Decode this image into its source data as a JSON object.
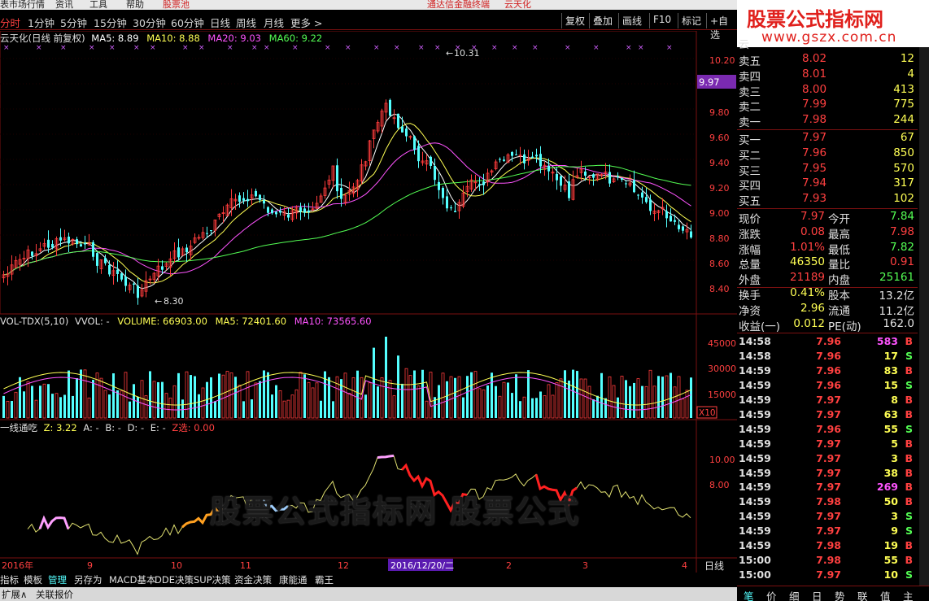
{
  "top_menu": [
    "表市场行情",
    "资讯",
    "工具",
    "帮助",
    "股票池",
    "通达信金融终端",
    "云天化"
  ],
  "period_tabs": [
    "分时",
    "1分钟",
    "5分钟",
    "15分钟",
    "30分钟",
    "60分钟",
    "日线",
    "周线",
    "月线",
    "更多 >"
  ],
  "right_buttons": [
    "复权",
    "叠加",
    "画线",
    "F10",
    "标记",
    "+自选"
  ],
  "logo": {
    "line1": "股票公式指标网",
    "line2": "www.gszx.com.cn"
  },
  "main_legend": {
    "title": "云天化(日线 前复权)",
    "ma5": "MA5: 8.89",
    "ma10": "MA10: 8.88",
    "ma20": "MA20: 9.03",
    "ma60": "MA60: 9.22"
  },
  "price_axis": [
    "10.20",
    "9.80",
    "9.60",
    "9.40",
    "9.20",
    "9.00",
    "8.80",
    "8.60",
    "8.40"
  ],
  "current_price_badge": "9.97",
  "annotations": {
    "high": "10.31",
    "low": "8.30"
  },
  "vol_legend": {
    "name": "VOL-TDX(5,10)",
    "vvol": "VVOL: -",
    "volume": "VOLUME: 66903.00",
    "ma5": "MA5: 72401.60",
    "ma10": "MA10: 73565.60"
  },
  "vol_axis": [
    "45000",
    "30000",
    "15000"
  ],
  "vol_unit": "X10",
  "ind_legend": {
    "name": "一线通吃",
    "z": "Z: 3.22",
    "a": "A: -",
    "b": "B: -",
    "d": "D: -",
    "e": "E: -",
    "zx": "Z选: 0.00"
  },
  "ind_axis": [
    "10.00",
    "8.00"
  ],
  "watermark": "股票公式指标网 股票公式",
  "date_axis": {
    "labels": [
      "2016年",
      "9",
      "10",
      "11",
      "12",
      "2016/12/20/二",
      "2",
      "3",
      "4"
    ],
    "period": "日线"
  },
  "quote": {
    "stock_short": "云",
    "sells": [
      {
        "label": "卖五",
        "price": "8.02",
        "vol": "12"
      },
      {
        "label": "卖四",
        "price": "8.01",
        "vol": "4"
      },
      {
        "label": "卖三",
        "price": "8.00",
        "vol": "413"
      },
      {
        "label": "卖二",
        "price": "7.99",
        "vol": "775"
      },
      {
        "label": "卖一",
        "price": "7.98",
        "vol": "244"
      }
    ],
    "buys": [
      {
        "label": "买一",
        "price": "7.97",
        "vol": "67"
      },
      {
        "label": "买二",
        "price": "7.96",
        "vol": "850"
      },
      {
        "label": "买三",
        "price": "7.95",
        "vol": "570"
      },
      {
        "label": "买四",
        "price": "7.94",
        "vol": "317"
      },
      {
        "label": "买五",
        "price": "7.93",
        "vol": "102"
      }
    ],
    "stats": [
      {
        "l1": "现价",
        "v1": "7.97",
        "l2": "今开",
        "v2": "7.84"
      },
      {
        "l1": "涨跌",
        "v1": "0.08",
        "l2": "最高",
        "v2": "7.98"
      },
      {
        "l1": "涨幅",
        "v1": "1.01%",
        "l2": "最低",
        "v2": "7.82"
      },
      {
        "l1": "总量",
        "v1": "46350",
        "l2": "量比",
        "v2": "0.91"
      },
      {
        "l1": "外盘",
        "v1": "21189",
        "l2": "内盘",
        "v2": "25161"
      },
      {
        "l1": "换手",
        "v1": "0.41%",
        "l2": "股本",
        "v2": "13.2亿"
      },
      {
        "l1": "净资",
        "v1": "2.96",
        "l2": "流通",
        "v2": "11.2亿"
      },
      {
        "l1": "收益(一)",
        "v1": "0.012",
        "l2": "PE(动)",
        "v2": "162.0"
      }
    ]
  },
  "ticks": [
    {
      "time": "14:58",
      "price": "7.96",
      "vol": "583",
      "bs": "B"
    },
    {
      "time": "14:58",
      "price": "7.96",
      "vol": "17",
      "bs": "S"
    },
    {
      "time": "14:59",
      "price": "7.96",
      "vol": "83",
      "bs": "B"
    },
    {
      "time": "14:59",
      "price": "7.96",
      "vol": "15",
      "bs": "S"
    },
    {
      "time": "14:59",
      "price": "7.97",
      "vol": "8",
      "bs": "B"
    },
    {
      "time": "14:59",
      "price": "7.97",
      "vol": "63",
      "bs": "B"
    },
    {
      "time": "14:59",
      "price": "7.96",
      "vol": "55",
      "bs": "S"
    },
    {
      "time": "14:59",
      "price": "7.97",
      "vol": "5",
      "bs": "B"
    },
    {
      "time": "14:59",
      "price": "7.97",
      "vol": "3",
      "bs": "B"
    },
    {
      "time": "14:59",
      "price": "7.97",
      "vol": "38",
      "bs": "B"
    },
    {
      "time": "14:59",
      "price": "7.97",
      "vol": "269",
      "bs": "B"
    },
    {
      "time": "14:59",
      "price": "7.98",
      "vol": "50",
      "bs": "B"
    },
    {
      "time": "14:59",
      "price": "7.97",
      "vol": "3",
      "bs": "S"
    },
    {
      "time": "14:59",
      "price": "7.97",
      "vol": "9",
      "bs": "S"
    },
    {
      "time": "14:59",
      "price": "7.98",
      "vol": "19",
      "bs": "B"
    },
    {
      "time": "15:00",
      "price": "7.98",
      "vol": "55",
      "bs": "B"
    },
    {
      "time": "15:00",
      "price": "7.97",
      "vol": "10",
      "bs": "S"
    }
  ],
  "bottom_tabs": [
    "指标",
    "模板",
    "管理",
    "另存为",
    "MACD基本",
    "DDE决策",
    "SUP决策",
    "资金决策",
    "康能通",
    "霸王"
  ],
  "status": [
    "扩展∧",
    "关联报价"
  ],
  "right_tabs": [
    "笔",
    "价",
    "细",
    "日",
    "势",
    "联",
    "值",
    "主"
  ],
  "colors": {
    "up": "#ff3c3c",
    "down": "#54ffff",
    "ma5": "#ffffff",
    "ma10": "#ffff54",
    "ma20": "#ff54ff",
    "ma60": "#54ff54"
  }
}
